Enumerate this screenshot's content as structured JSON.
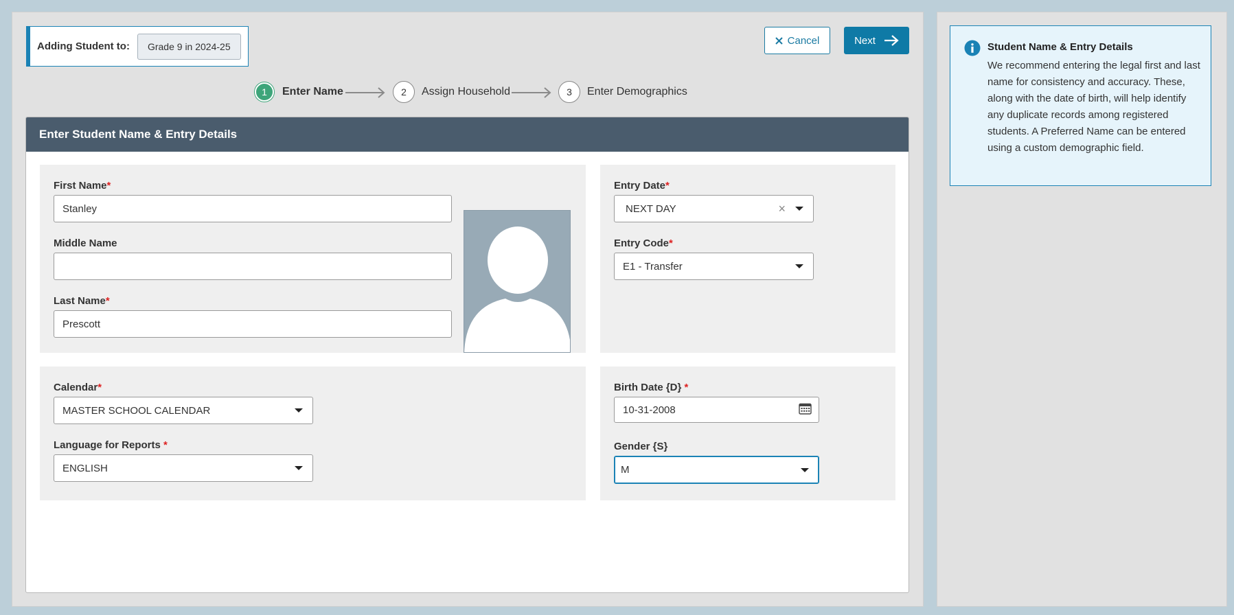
{
  "header": {
    "adding_label": "Adding Student to:",
    "grade_pill": "Grade 9 in 2024-25"
  },
  "actions": {
    "cancel_label": "Cancel",
    "next_label": "Next"
  },
  "steps": [
    {
      "number": "1",
      "label": "Enter Name",
      "active": true
    },
    {
      "number": "2",
      "label": "Assign Household",
      "active": false
    },
    {
      "number": "3",
      "label": "Enter Demographics",
      "active": false
    }
  ],
  "card": {
    "title": "Enter Student Name & Entry Details"
  },
  "form": {
    "first_name": {
      "label": "First Name",
      "required_mark": "*",
      "value": "Stanley"
    },
    "middle_name": {
      "label": "Middle Name",
      "value": ""
    },
    "last_name": {
      "label": "Last Name",
      "required_mark": "*",
      "value": "Prescott"
    },
    "entry_date": {
      "label": "Entry Date",
      "required_mark": "*",
      "value": "NEXT DAY"
    },
    "entry_code": {
      "label": "Entry Code",
      "required_mark": "*",
      "value": "E1 - Transfer"
    },
    "calendar": {
      "label": "Calendar",
      "required_mark": "*",
      "value": "MASTER SCHOOL CALENDAR"
    },
    "language": {
      "label": "Language for Reports ",
      "required_mark": "*",
      "value": "ENGLISH"
    },
    "birth_date": {
      "label": "Birth Date {D} ",
      "required_mark": "*",
      "value": "10-31-2008"
    },
    "gender": {
      "label": "Gender {S}",
      "value": "M"
    }
  },
  "info": {
    "title": "Student Name & Entry Details",
    "text": "We recommend entering the legal first and last name for consistency and accuracy. These, along with the date of birth, will help identify any duplicate records among registered students. A Preferred Name can be entered using a custom demographic field."
  },
  "icons": {
    "cancel": "close-icon",
    "next": "arrow-right-icon",
    "info": "info-icon",
    "calendar": "calendar-icon",
    "avatar": "person-silhouette"
  },
  "colors": {
    "accent": "#1a82b5",
    "primary_button": "#0f7aa6",
    "step_active": "#3ea57a",
    "card_header": "#4a5c6d",
    "required": "#dd2222"
  }
}
